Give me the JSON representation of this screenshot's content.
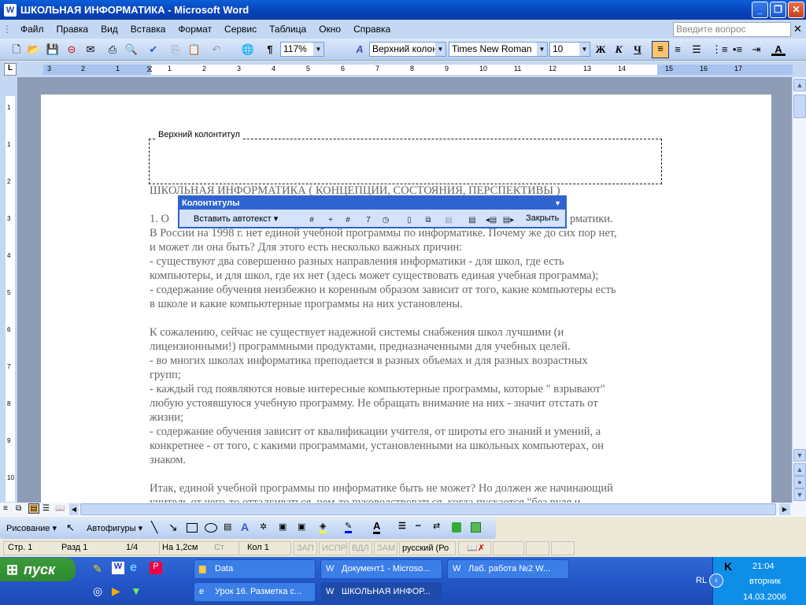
{
  "window": {
    "title": "ШКОЛЬНАЯ ИНФОРМАТИКА - Microsoft Word",
    "app_icon": "W"
  },
  "menu": [
    "Файл",
    "Правка",
    "Вид",
    "Вставка",
    "Формат",
    "Сервис",
    "Таблица",
    "Окно",
    "Справка"
  ],
  "help_placeholder": "Введите вопрос",
  "toolbar": {
    "zoom": "117%",
    "style": "Верхний колонт",
    "font": "Times New Roman",
    "size": "10",
    "bold": "Ж",
    "italic": "К",
    "underline": "Ч",
    "pilcrow": "¶",
    "font_color": "A"
  },
  "ruler_numbers": [
    "3",
    "2",
    "1",
    "1",
    "2",
    "3",
    "4",
    "5",
    "6",
    "7",
    "8",
    "9",
    "10",
    "11",
    "12",
    "13",
    "14",
    "15",
    "16",
    "17"
  ],
  "vruler_numbers": [
    "1",
    "1",
    "2",
    "3",
    "4",
    "5",
    "6",
    "7",
    "8",
    "9",
    "10"
  ],
  "header_label": "Верхний колонтитул",
  "doc_lines": [
    "ШКОЛЬНАЯ ИНФОРМАТИКА ( КОНЦЕПЦИИ, СОСТОЯНИЯ, ПЕРСПЕКТИВЫ )",
    "1. О",
    "В России на 1998 г. нет единой учебной программы по информатике. Почему же до сих пор нет,",
    "и может ли она быть? Для этого есть несколько важных причин:",
    "- существуют два совершенно разных направления информатики - для школ, где есть",
    "компьютеры, и для школ, где их нет (здесь может существовать единая учебная программа);",
    "- содержание обучения неизбежно и коренным образом зависит от того, какие компьютеры есть",
    "в школе и какие компьютерные программы на них установлены.",
    "",
    "К сожалению, сейчас не существует надежной системы снабжения школ лучшими (и",
    "лицензионными!) программными продуктами, предназначенными для учебных целей.",
    "- во многих школах информатика преподается в разных объемах и для разных возрастных",
    "групп;",
    "- каждый год появляются новые интересные компьютерные программы, которые \" взрывают\"",
    "любую устоявшуюся учебную программу. Не обращать внимание на них - значит отстать от",
    "жизни;",
    "- содержание обучения зависит от квалификации учителя, от широты его знаний и умений, а",
    "конкретнее - от того, с какими программами, установленными на школьных компьютерах, он",
    "знаком.",
    "",
    "Итак, единой учебной программы по информатике быть не может? Но должен же начинающий",
    "учитель от чего-то отталкиваться, чем-то руководствоваться, когда пускается \"без руля и"
  ],
  "line1_tail": "рматики.",
  "hf_toolbar": {
    "title": "Колонтитулы",
    "autotext": "Вставить автотекст ▾",
    "close": "Закрыть"
  },
  "draw_toolbar": {
    "drawing": "Рисование ▾",
    "autoshapes": "Автофигуры ▾"
  },
  "status": {
    "page": "Стр. 1",
    "section": "Разд 1",
    "pages": "1/4",
    "at": "На 1,2см",
    "line": "Ст",
    "col": "Кол 1",
    "rec": "ЗАП",
    "trk": "ИСПР",
    "ext": "ВДЛ",
    "ovr": "ЗАМ",
    "lang": "русский (Ро"
  },
  "taskbar": {
    "start": "пуск",
    "buttons": [
      "Data",
      "Документ1 - Microso...",
      "Лаб. работа №2 W...",
      "Урок 16. Разметка с...",
      "ШКОЛЬНАЯ ИНФОР..."
    ],
    "lang": "RL",
    "time": "21:04",
    "day": "вторник",
    "date": "14.03.2006"
  }
}
